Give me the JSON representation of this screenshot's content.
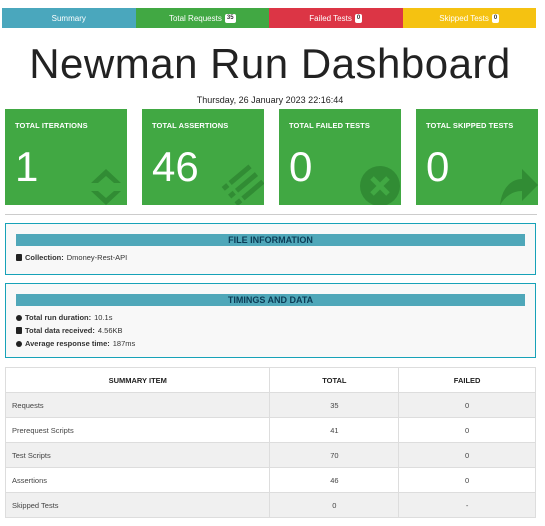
{
  "tabs": [
    {
      "label": "Summary",
      "badge": null,
      "color": "#4aa7bd"
    },
    {
      "label": "Total Requests",
      "badge": "35",
      "color": "#41a843"
    },
    {
      "label": "Failed Tests",
      "badge": "0",
      "color": "#dc3545"
    },
    {
      "label": "Skipped Tests",
      "badge": "0",
      "color": "#f5c211"
    }
  ],
  "title": "Newman Run Dashboard",
  "date": "Thursday, 26 January 2023 22:16:44",
  "cards": [
    {
      "label": "TOTAL ITERATIONS",
      "value": "1",
      "icon": "refresh-icon"
    },
    {
      "label": "TOTAL ASSERTIONS",
      "value": "46",
      "icon": "list-check-icon"
    },
    {
      "label": "TOTAL FAILED TESTS",
      "value": "0",
      "icon": "times-circle-icon"
    },
    {
      "label": "TOTAL SKIPPED TESTS",
      "value": "0",
      "icon": "share-arrow-icon"
    }
  ],
  "file_info": {
    "heading": "FILE INFORMATION",
    "collection_label": "Collection:",
    "collection_value": "Dmoney-Rest-API"
  },
  "timings": {
    "heading": "TIMINGS AND DATA",
    "duration_label": "Total run duration:",
    "duration_value": "10.1s",
    "data_label": "Total data received:",
    "data_value": "4.56KB",
    "response_label": "Average response time:",
    "response_value": "187ms"
  },
  "summary_table": {
    "headers": [
      "SUMMARY ITEM",
      "TOTAL",
      "FAILED"
    ],
    "rows": [
      {
        "item": "Requests",
        "total": "35",
        "failed": "0"
      },
      {
        "item": "Prerequest Scripts",
        "total": "41",
        "failed": "0"
      },
      {
        "item": "Test Scripts",
        "total": "70",
        "failed": "0"
      },
      {
        "item": "Assertions",
        "total": "46",
        "failed": "0"
      },
      {
        "item": "Skipped Tests",
        "total": "0",
        "failed": "-"
      }
    ]
  },
  "colors": {
    "accent_green": "#41a843",
    "panel_border": "#17a2b8",
    "panel_header": "#4fa7b9"
  }
}
